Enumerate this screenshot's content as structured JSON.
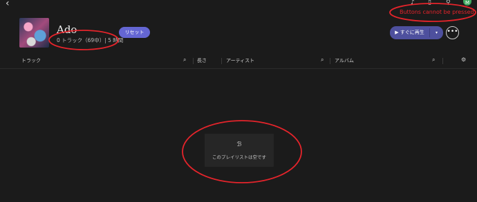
{
  "topbar": {
    "back_icon": "‹",
    "icons": [
      "bell-icon",
      "people-icon",
      "person-icon"
    ],
    "avatar_letter": "M"
  },
  "playlist": {
    "title": "Ado",
    "meta": "0 トラック（69中）| 5 時間",
    "reset_label": "リセット"
  },
  "actions": {
    "play_label": "▶ すぐに再生",
    "dropdown_icon": "▾",
    "more_icon": "•••"
  },
  "columns": {
    "track": "トラック",
    "length": "長さ",
    "artist": "アーティスト",
    "album": "アルバム"
  },
  "empty_state": {
    "icon": "ℬ",
    "text": "このプレイリストは空です"
  },
  "annotation": {
    "text": "Buttons cannot be pressed.",
    "color": "#e5242b"
  },
  "colors": {
    "background": "#1b1b1b",
    "accent": "#6466d3",
    "play": "#4e509e",
    "annotation": "#e5242b"
  }
}
